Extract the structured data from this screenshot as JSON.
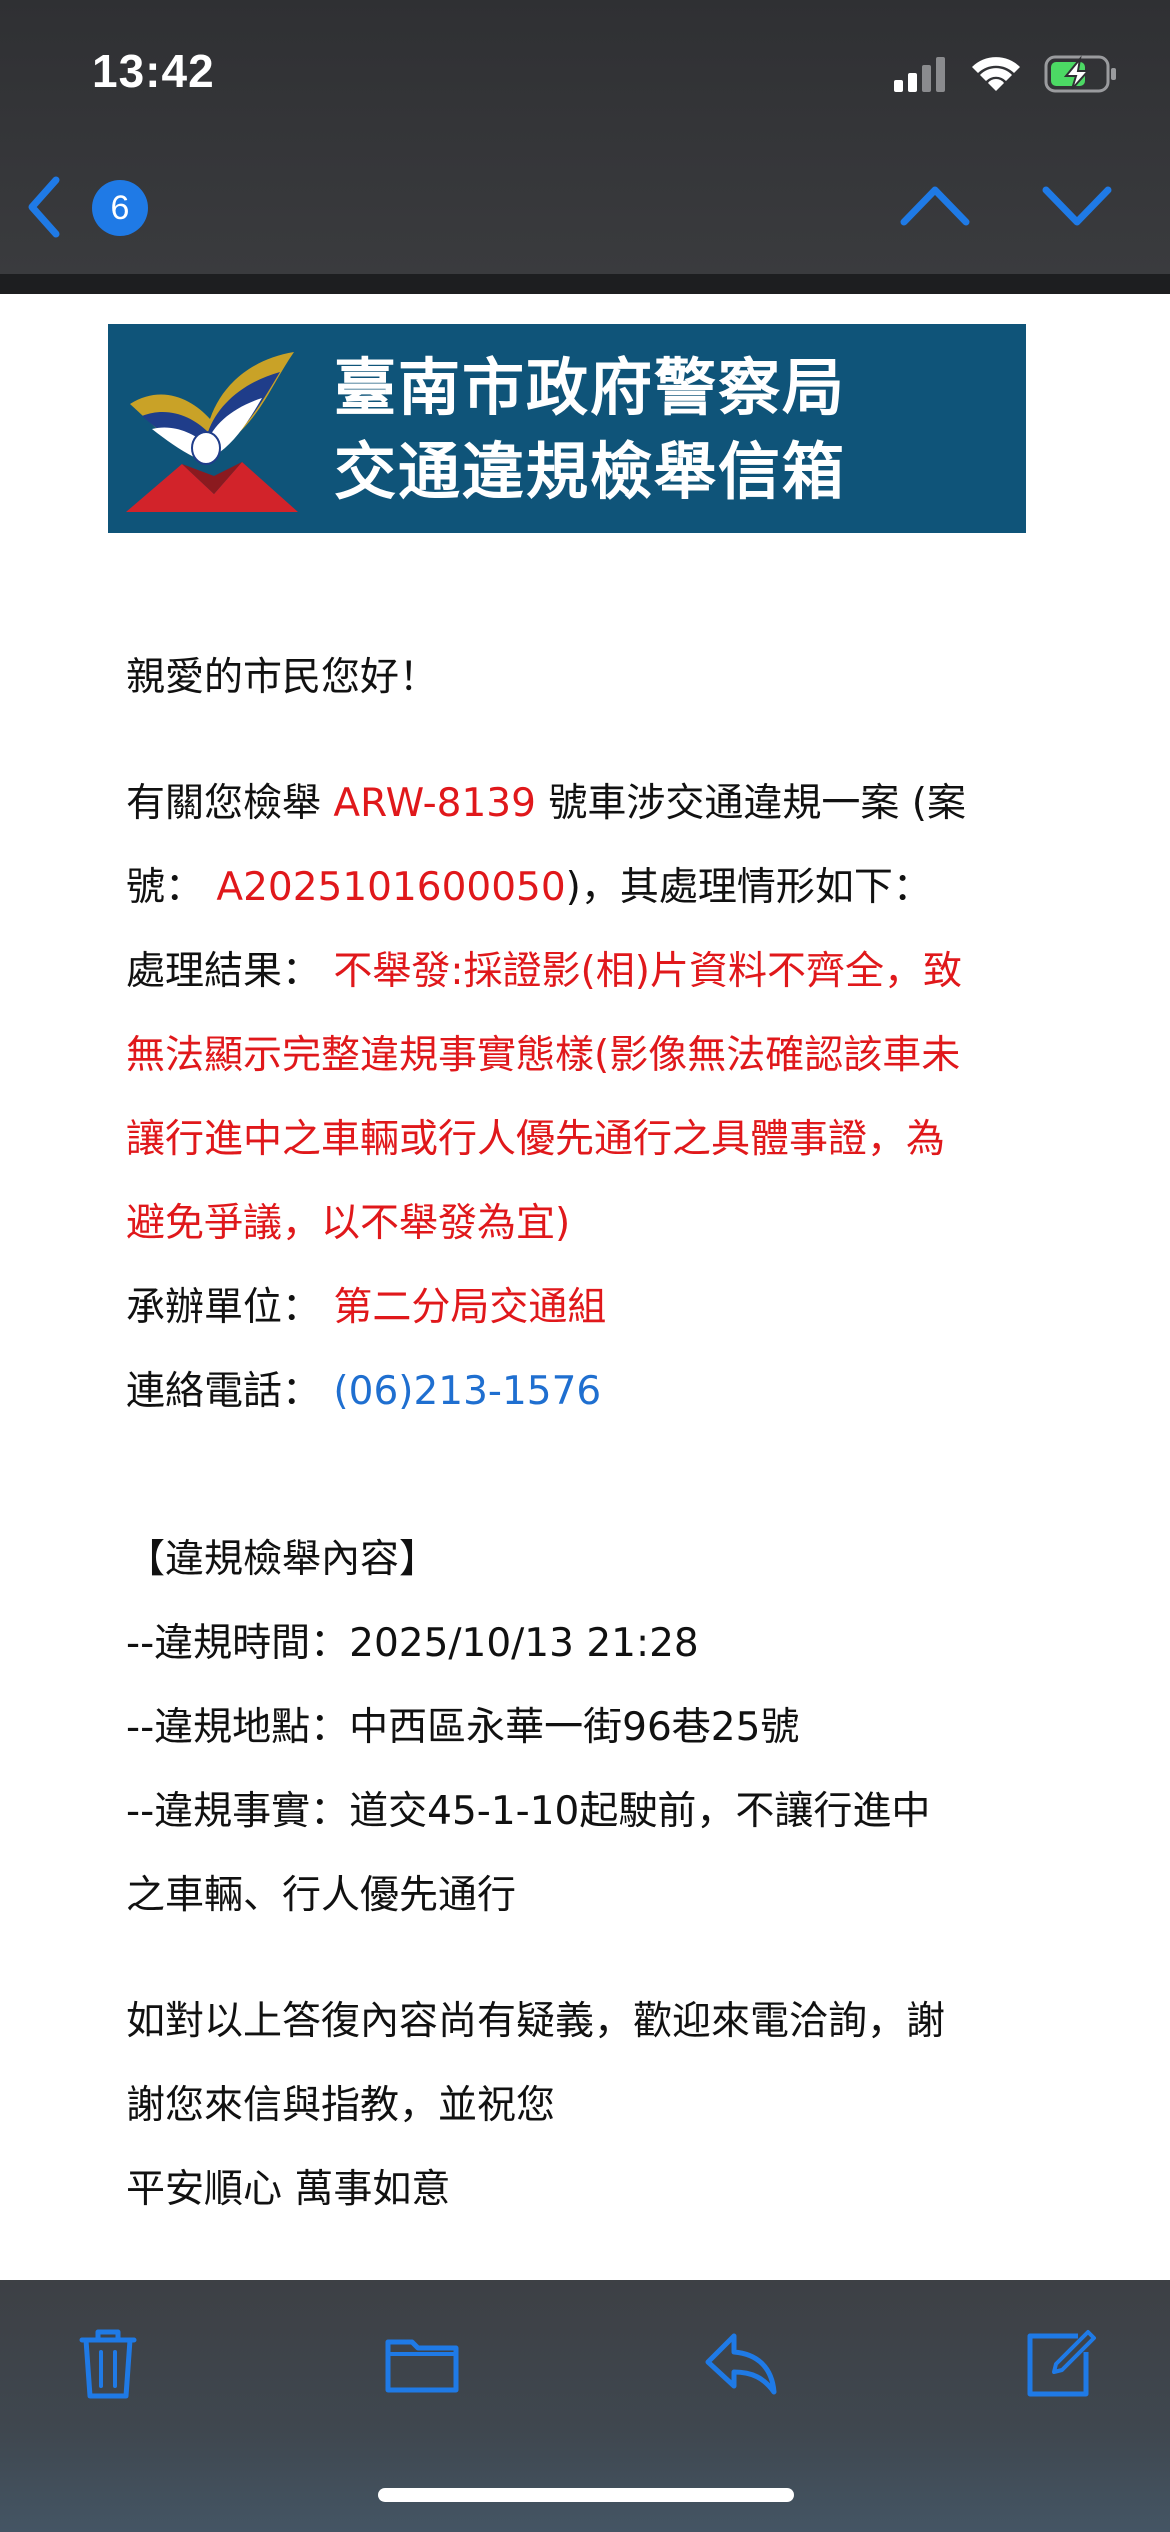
{
  "status_bar": {
    "time": "13:42"
  },
  "nav": {
    "unread_count": "6"
  },
  "banner": {
    "title_line1": "臺南市政府警察局",
    "title_line2": "交通違規檢舉信箱"
  },
  "email": {
    "greeting": "親愛的市民您好！",
    "intro_prefix": "有關您檢舉",
    "plate": "ARW-8139",
    "intro_suffix": "號車涉交通違規一案 (案",
    "case_prefix": "號：",
    "case_number": "A2025101600050",
    "case_suffix": ")，其處理情形如下：",
    "result_label": "處理結果：",
    "result_lines": [
      "不舉發:採證影(相)片資料不齊全，致",
      "無法顯示完整違規事實態樣(影像無法確認該車未",
      "讓行進中之車輛或行人優先通行之具體事證，為",
      "避免爭議，以不舉發為宜)"
    ],
    "unit_label": "承辦單位：",
    "unit_value": "第二分局交通組",
    "phone_label": "連絡電話：",
    "phone_value": "(06)213-1576",
    "section_title": "【違規檢舉內容】",
    "detail_time": "--違規時間：2025/10/13 21:28",
    "detail_place": "--違規地點：中西區永華一街96巷25號",
    "detail_fact_line1": "--違規事實：道交45-1-10起駛前，不讓行進中",
    "detail_fact_line2": "之車輛、行人優先通行",
    "closing_line1": "如對以上答復內容尚有疑義，歡迎來電洽詢，謝",
    "closing_line2": "謝您來信與指教，並祝您",
    "closing_line3": "平安順心 萬事如意"
  },
  "colors": {
    "accent_blue": "#1f7ae6",
    "banner_blue": "#0f5479",
    "highlight_red": "#e0181b",
    "link_blue": "#1f6fd0"
  },
  "icons": [
    "back-chevron-icon",
    "signal-icon",
    "wifi-icon",
    "battery-charging-icon",
    "chevron-up-icon",
    "chevron-down-icon",
    "trash-icon",
    "folder-icon",
    "reply-icon",
    "compose-icon"
  ]
}
